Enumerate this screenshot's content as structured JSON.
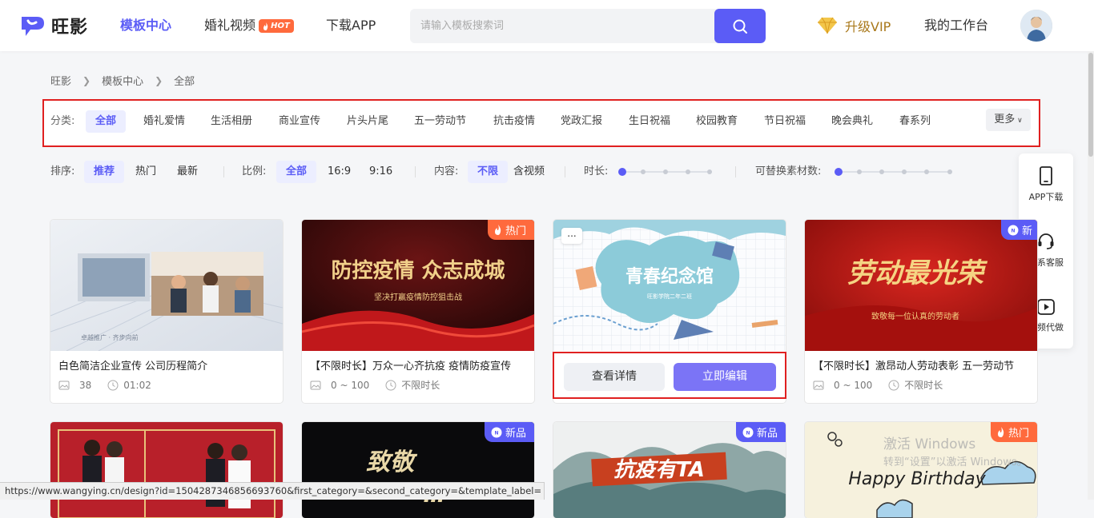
{
  "header": {
    "brand": "旺影",
    "nav": [
      "模板中心",
      "婚礼视频",
      "下载APP"
    ],
    "hot_badge": "HOT",
    "search_placeholder": "请输入模板搜索词",
    "vip_label": "升级VIP",
    "workbench_label": "我的工作台"
  },
  "breadcrumb": [
    "旺影",
    "模板中心",
    "全部"
  ],
  "categories": {
    "label": "分类:",
    "items": [
      "全部",
      "婚礼爱情",
      "生活相册",
      "商业宣传",
      "片头片尾",
      "五一劳动节",
      "抗击疫情",
      "党政汇报",
      "生日祝福",
      "校园教育",
      "节日祝福",
      "晚会典礼",
      "春系列"
    ],
    "active": "全部",
    "more_label": "更多"
  },
  "filters": {
    "sort_label": "排序:",
    "sort_options": [
      "推荐",
      "热门",
      "最新"
    ],
    "sort_active": "推荐",
    "ratio_label": "比例:",
    "ratio_options": [
      "全部",
      "16:9",
      "9:16"
    ],
    "ratio_active": "全部",
    "content_label": "内容:",
    "content_options": [
      "不限",
      "含视频"
    ],
    "content_active": "不限",
    "duration_label": "时长:",
    "materials_label": "可替换素材数:"
  },
  "side_panel": [
    {
      "label": "APP下载",
      "icon": "phone-icon"
    },
    {
      "label": "联系客服",
      "icon": "headset-icon"
    },
    {
      "label": "视频代做",
      "icon": "play-icon"
    }
  ],
  "cards": [
    {
      "title": "白色简洁企业宣传 公司历程简介",
      "count": "38",
      "duration": "01:02",
      "badge": "",
      "thumb_text": "卓越推广 · 齐步向前"
    },
    {
      "title": "【不限时长】万众一心齐抗疫 疫情防疫宣传",
      "count": "0 ~ 100",
      "duration": "不限时长",
      "badge": "热门",
      "thumb_text": "防控疫情 众志成城",
      "thumb_sub": "坚决打赢疫情防控狙击战"
    },
    {
      "title": "青春纪念馆",
      "count": "",
      "duration": "",
      "badge": "",
      "thumb_text": "青春纪念馆",
      "thumb_sub": "旺影学院二年二班"
    },
    {
      "title": "【不限时长】激昂动人劳动表彰 五一劳动节",
      "count": "0 ~ 100",
      "duration": "不限时长",
      "badge": "新",
      "thumb_text": "劳动最光荣",
      "thumb_sub": "致敬每一位认真的劳动者"
    },
    {
      "badge": "",
      "thumb_text": ""
    },
    {
      "badge": "新品",
      "thumb_text": "致敬"
    },
    {
      "badge": "新品",
      "thumb_text": "抗疫有TA"
    },
    {
      "badge": "热门",
      "thumb_text": "Happy Birthday"
    }
  ],
  "hover_actions": {
    "detail": "查看详情",
    "edit": "立即编辑",
    "more": "..."
  },
  "status_url": "https://www.wangying.cn/design?id=1504287346856693760&first_category=&second_category=&template_label=",
  "watermark": {
    "line1": "激活 Windows",
    "line2": "转到“设置”以激活 Windows。"
  },
  "colors": {
    "accent": "#5b5cf6",
    "hot": "#ff6a3d",
    "highlight_border": "#e02020"
  }
}
